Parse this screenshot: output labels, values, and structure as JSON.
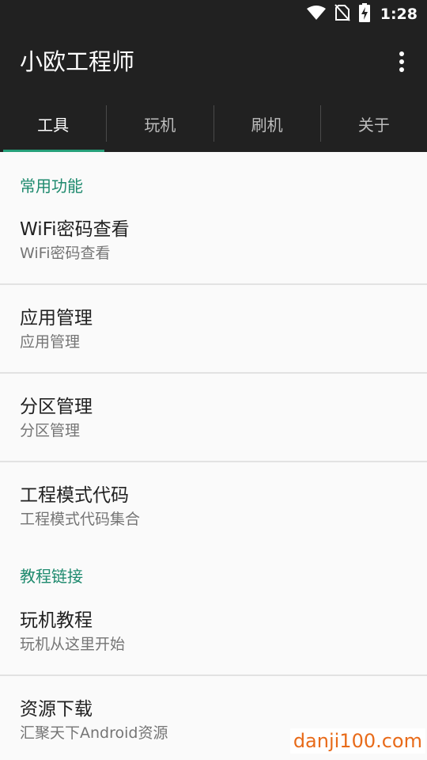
{
  "status_bar": {
    "time": "1:28",
    "icons": [
      "wifi-icon",
      "no-sim-icon",
      "battery-charging-icon"
    ]
  },
  "app_bar": {
    "title": "小欧工程师",
    "overflow_icon": "more-vert-icon"
  },
  "tabs": [
    {
      "label": "工具",
      "active": true
    },
    {
      "label": "玩机",
      "active": false
    },
    {
      "label": "刷机",
      "active": false
    },
    {
      "label": "关于",
      "active": false
    }
  ],
  "sections": [
    {
      "header": "常用功能",
      "items": [
        {
          "title": "WiFi密码查看",
          "summary": "WiFi密码查看"
        },
        {
          "title": "应用管理",
          "summary": "应用管理"
        },
        {
          "title": "分区管理",
          "summary": "分区管理"
        },
        {
          "title": "工程模式代码",
          "summary": "工程模式代码集合"
        }
      ]
    },
    {
      "header": "教程链接",
      "items": [
        {
          "title": "玩机教程",
          "summary": "玩机从这里开始"
        },
        {
          "title": "资源下载",
          "summary": "汇聚天下Android资源"
        }
      ]
    }
  ],
  "watermark": "danji100.com",
  "colors": {
    "app_bar": "#212121",
    "accent": "#26a07a",
    "section_header": "#1e8a6e",
    "background": "#fafafa",
    "watermark": "#e86b1a"
  }
}
